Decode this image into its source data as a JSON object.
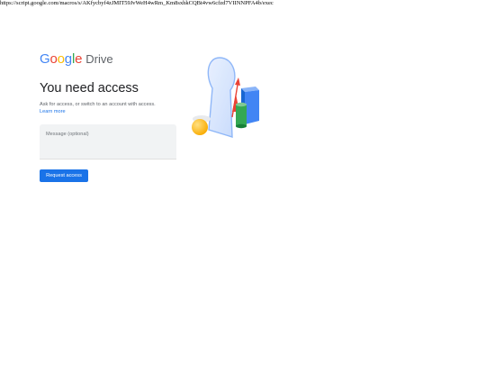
{
  "browser": {
    "url": "https://script.google.com/macros/s/AKfycbyf4zJMIT59JvWeH4wRm_Km8sxhkCQBt4vw6cfzd7VIINNPFA4b/exec"
  },
  "brand": {
    "google_letters": [
      "G",
      "o",
      "o",
      "g",
      "l",
      "e"
    ],
    "product": "Drive",
    "colors": {
      "blue": "#4285f4",
      "red": "#ea4335",
      "yellow": "#fbbc05",
      "green": "#34a853"
    }
  },
  "main": {
    "title": "You need access",
    "description": "Ask for access, or switch to an account with access.",
    "learn_more": "Learn more",
    "message_placeholder": "Message (optional)",
    "message_value": "",
    "request_button": "Request access",
    "accent_color": "#1a73e8"
  },
  "illustration": {
    "icon": "keyhole-shapes-illustration"
  }
}
